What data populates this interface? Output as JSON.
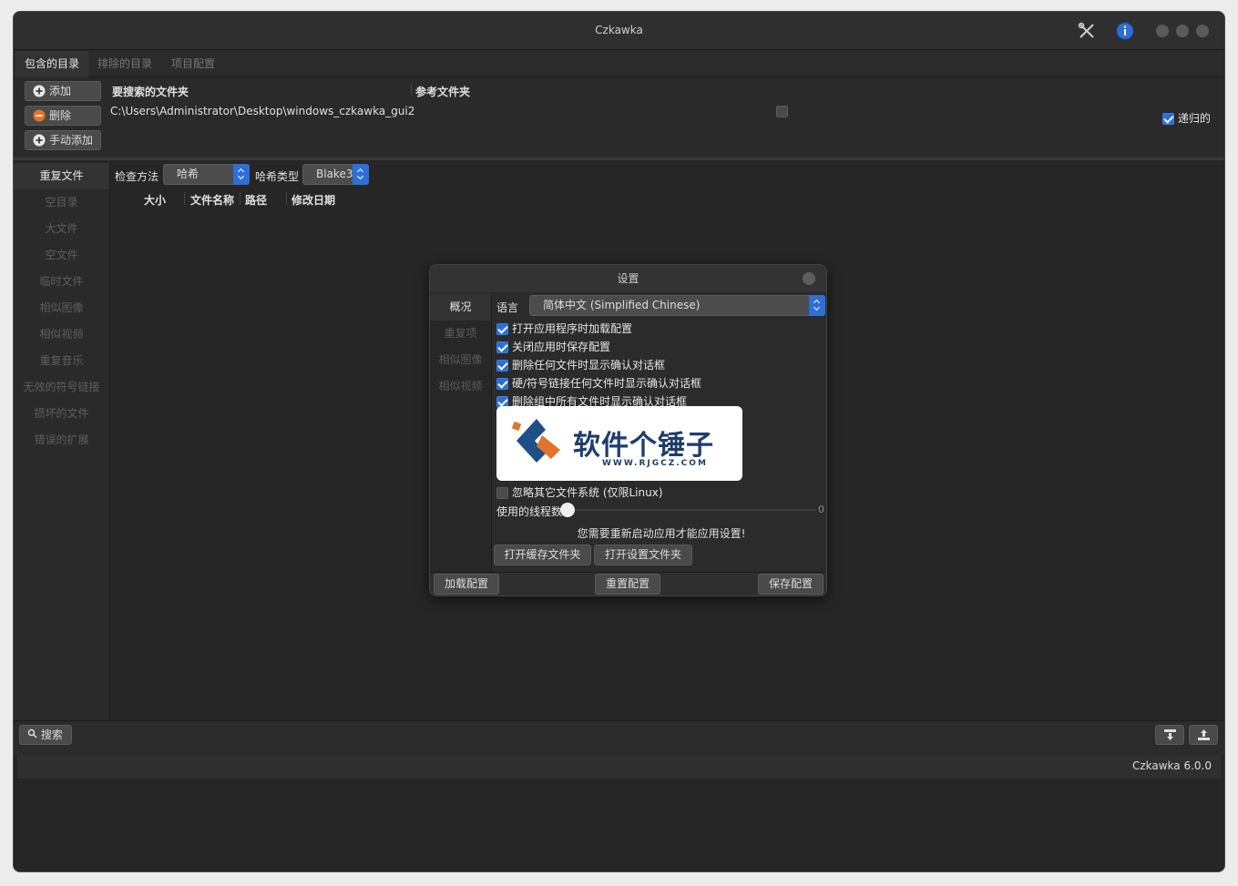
{
  "window": {
    "title": "Czkawka"
  },
  "top_tabs": [
    "包含的目录",
    "排除的目录",
    "项目配置"
  ],
  "dir_panel": {
    "add_label": "添加",
    "remove_label": "删除",
    "manual_add_label": "手动添加",
    "col_search": "要搜索的文件夹",
    "col_reference": "参考文件夹",
    "path": "C:\\Users\\Administrator\\Desktop\\windows_czkawka_gui2",
    "recursive_label": "递归的"
  },
  "sidebar": {
    "items": [
      "重复文件",
      "空目录",
      "大文件",
      "空文件",
      "临时文件",
      "相似图像",
      "相似视频",
      "重复音乐",
      "无效的符号链接",
      "损坏的文件",
      "错误的扩展"
    ]
  },
  "toolbar": {
    "check_method_label": "检查方法",
    "check_method_value": "哈希",
    "hash_type_label": "哈希类型",
    "hash_type_value": "Blake3"
  },
  "columns": [
    "大小",
    "文件名称",
    "路径",
    "修改日期"
  ],
  "bottom": {
    "search_label": "搜索"
  },
  "status": {
    "version": "Czkawka 6.0.0"
  },
  "dialog": {
    "title": "设置",
    "tabs": [
      "概况",
      "重复项",
      "相似图像",
      "相似视频"
    ],
    "language_label": "语言",
    "language_value": "简体中文 (Simplified Chinese)",
    "options": [
      "打开应用程序时加载配置",
      "关闭应用时保存配置",
      "删除任何文件时显示确认对话框",
      "硬/符号链接任何文件时显示确认对话框",
      "删除组中所有文件时显示确认对话框"
    ],
    "ignore_fs_label": "忽略其它文件系统 (仅限Linux)",
    "threads_label": "使用的线程数",
    "threads_value": "0",
    "restart_note": "您需要重新启动应用才能应用设置!",
    "open_cache_label": "打开缓存文件夹",
    "open_settings_label": "打开设置文件夹",
    "load_config_label": "加载配置",
    "reset_config_label": "重置配置",
    "save_config_label": "保存配置"
  },
  "watermark": {
    "name": "软件个锤子",
    "url": "WWW.RJGCZ.COM"
  },
  "colors": {
    "accent": "#2d6fd6",
    "bg": "#262626"
  }
}
